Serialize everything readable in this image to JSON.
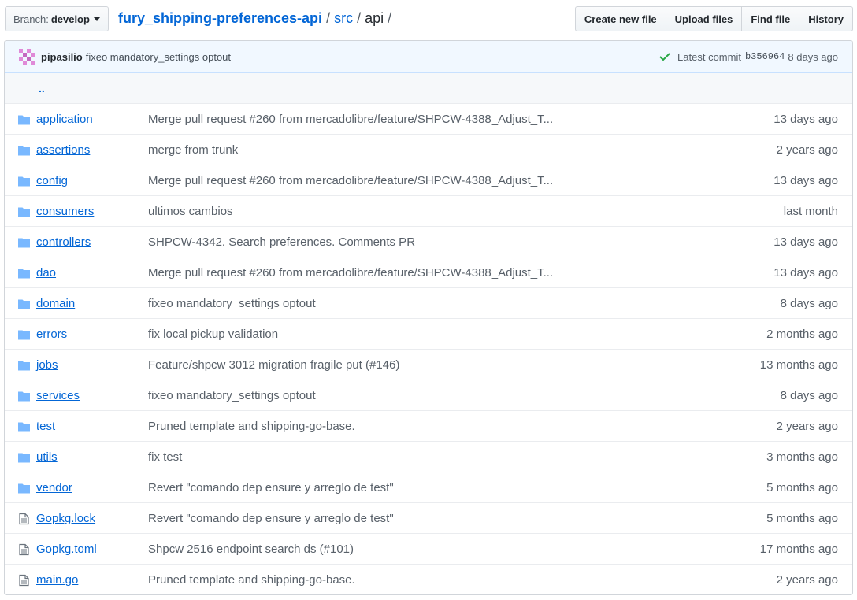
{
  "branch": {
    "label": "Branch:",
    "name": "develop"
  },
  "breadcrumb": {
    "repo": "fury_shipping-preferences-api",
    "parts": [
      "src"
    ],
    "current": "api",
    "separator": "/"
  },
  "actions": {
    "create": "Create new file",
    "upload": "Upload files",
    "find": "Find file",
    "history": "History"
  },
  "commit": {
    "author": "pipasilio",
    "message": "fixeo mandatory_settings optout",
    "latest_label": "Latest commit",
    "sha": "b356964",
    "age": "8 days ago",
    "status_color": "#28a745"
  },
  "parent_dir": "..",
  "colors": {
    "folder": "#79b8ff",
    "link": "#0366d6",
    "file": "#6a737d"
  },
  "files": [
    {
      "type": "dir",
      "icon": "folder-icon",
      "name": "application",
      "message": "Merge pull request #260 from mercadolibre/feature/SHPCW-4388_Adjust_T...",
      "age": "13 days ago"
    },
    {
      "type": "dir",
      "icon": "folder-icon",
      "name": "assertions",
      "message": "merge from trunk",
      "age": "2 years ago"
    },
    {
      "type": "dir",
      "icon": "folder-icon",
      "name": "config",
      "message": "Merge pull request #260 from mercadolibre/feature/SHPCW-4388_Adjust_T...",
      "age": "13 days ago"
    },
    {
      "type": "dir",
      "icon": "folder-icon",
      "name": "consumers",
      "message": "ultimos cambios",
      "age": "last month"
    },
    {
      "type": "dir",
      "icon": "folder-icon",
      "name": "controllers",
      "message": "SHPCW-4342. Search preferences. Comments PR",
      "age": "13 days ago"
    },
    {
      "type": "dir",
      "icon": "folder-icon",
      "name": "dao",
      "message": "Merge pull request #260 from mercadolibre/feature/SHPCW-4388_Adjust_T...",
      "age": "13 days ago"
    },
    {
      "type": "dir",
      "icon": "folder-icon",
      "name": "domain",
      "message": "fixeo mandatory_settings optout",
      "age": "8 days ago"
    },
    {
      "type": "dir",
      "icon": "folder-icon",
      "name": "errors",
      "message": "fix local pickup validation",
      "age": "2 months ago"
    },
    {
      "type": "dir",
      "icon": "folder-icon",
      "name": "jobs",
      "message": "Feature/shpcw 3012 migration fragile put (#146)",
      "age": "13 months ago"
    },
    {
      "type": "dir",
      "icon": "folder-icon",
      "name": "services",
      "message": "fixeo mandatory_settings optout",
      "age": "8 days ago"
    },
    {
      "type": "dir",
      "icon": "folder-icon",
      "name": "test",
      "message": "Pruned template and shipping-go-base.",
      "age": "2 years ago"
    },
    {
      "type": "dir",
      "icon": "folder-icon",
      "name": "utils",
      "message": "fix test",
      "age": "3 months ago"
    },
    {
      "type": "dir",
      "icon": "folder-icon",
      "name": "vendor",
      "message": "Revert \"comando dep ensure y arreglo de test\"",
      "age": "5 months ago"
    },
    {
      "type": "file",
      "icon": "file-icon",
      "name": "Gopkg.lock",
      "message": "Revert \"comando dep ensure y arreglo de test\"",
      "age": "5 months ago"
    },
    {
      "type": "file",
      "icon": "file-icon",
      "name": "Gopkg.toml",
      "message": "Shpcw 2516 endpoint search ds (#101)",
      "age": "17 months ago"
    },
    {
      "type": "file",
      "icon": "file-icon",
      "name": "main.go",
      "message": "Pruned template and shipping-go-base.",
      "age": "2 years ago"
    }
  ]
}
